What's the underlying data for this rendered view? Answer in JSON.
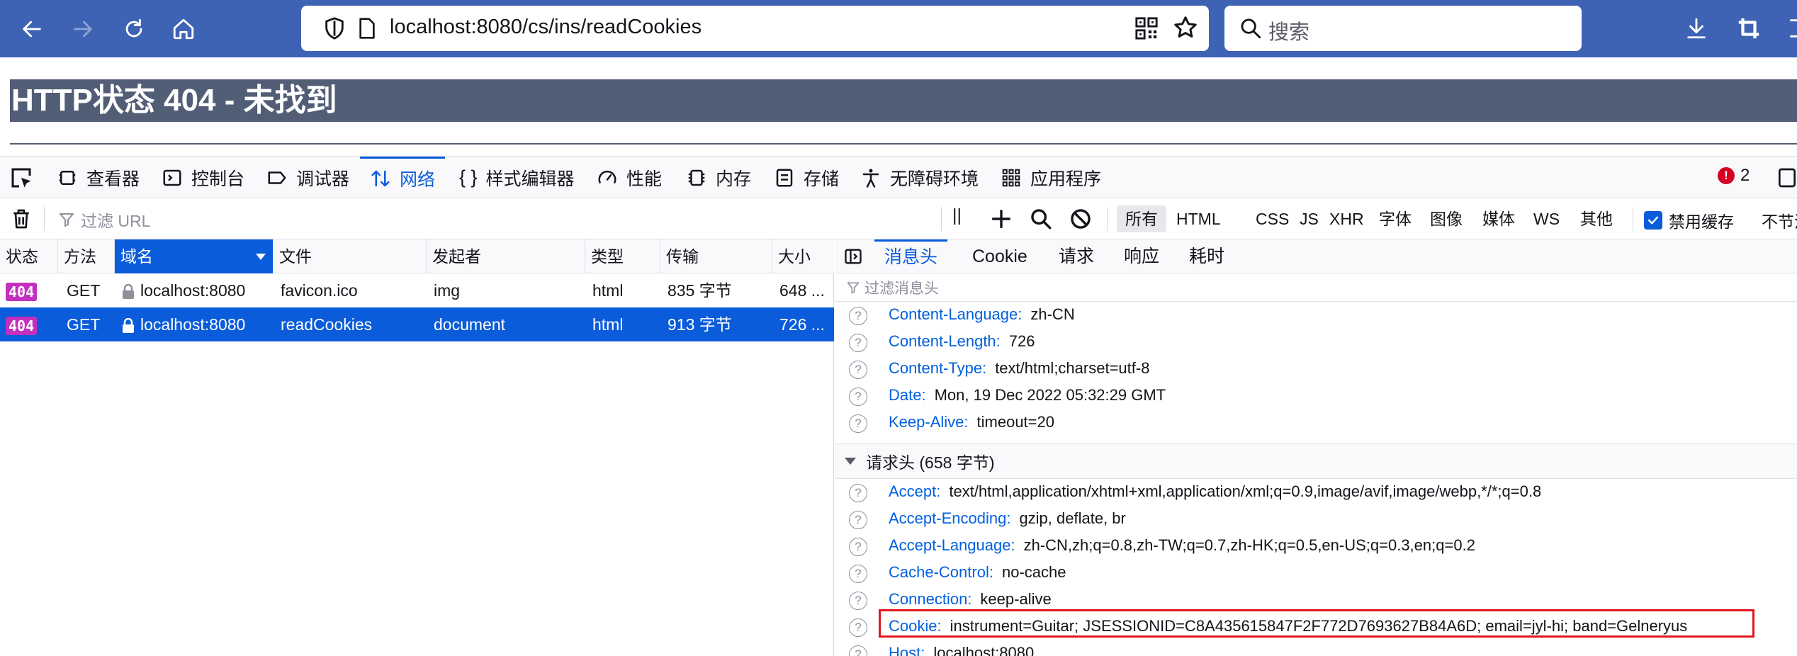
{
  "browser": {
    "url": "localhost:8080/cs/ins/readCookies",
    "search_placeholder": "搜索"
  },
  "page": {
    "error_title": "HTTP状态 404 - 未找到"
  },
  "devtools": {
    "tabs": [
      {
        "label": "查看器"
      },
      {
        "label": "控制台"
      },
      {
        "label": "调试器"
      },
      {
        "label": "网络"
      },
      {
        "label": "样式编辑器"
      },
      {
        "label": "性能"
      },
      {
        "label": "内存"
      },
      {
        "label": "存储"
      },
      {
        "label": "无障碍环境"
      },
      {
        "label": "应用程序"
      }
    ],
    "active_tab": "网络",
    "error_count": "2"
  },
  "network": {
    "filter_placeholder": "过滤 URL",
    "type_filters": [
      "所有",
      "HTML",
      "CSS",
      "JS",
      "XHR",
      "字体",
      "图像",
      "媒体",
      "WS",
      "其他"
    ],
    "active_filter": "所有",
    "disable_cache_label": "禁用缓存",
    "disable_cache_checked": true,
    "throttle_label": "不节流",
    "columns": [
      "状态",
      "方法",
      "域名",
      "文件",
      "发起者",
      "类型",
      "传输",
      "大小"
    ],
    "sorted_column": "域名",
    "requests": [
      {
        "status": "404",
        "method": "GET",
        "domain": "localhost:8080",
        "file": "favicon.ico",
        "initiator": "img",
        "type": "html",
        "transferred": "835 字节",
        "size": "648 ..."
      },
      {
        "status": "404",
        "method": "GET",
        "domain": "localhost:8080",
        "file": "readCookies",
        "initiator": "document",
        "type": "html",
        "transferred": "913 字节",
        "size": "726 ..."
      }
    ],
    "selected_request": 1
  },
  "details": {
    "tabs": [
      "消息头",
      "Cookie",
      "请求",
      "响应",
      "耗时"
    ],
    "active_tab": "消息头",
    "filter_placeholder": "过滤消息头",
    "response_headers": [
      {
        "name": "Content-Language:",
        "value": "zh-CN"
      },
      {
        "name": "Content-Length:",
        "value": "726"
      },
      {
        "name": "Content-Type:",
        "value": "text/html;charset=utf-8"
      },
      {
        "name": "Date:",
        "value": "Mon, 19 Dec 2022 05:32:29 GMT"
      },
      {
        "name": "Keep-Alive:",
        "value": "timeout=20"
      }
    ],
    "request_section_title": "请求头 (658 字节)",
    "request_headers": [
      {
        "name": "Accept:",
        "value": "text/html,application/xhtml+xml,application/xml;q=0.9,image/avif,image/webp,*/*;q=0.8"
      },
      {
        "name": "Accept-Encoding:",
        "value": "gzip, deflate, br"
      },
      {
        "name": "Accept-Language:",
        "value": "zh-CN,zh;q=0.8,zh-TW;q=0.7,zh-HK;q=0.5,en-US;q=0.3,en;q=0.2"
      },
      {
        "name": "Cache-Control:",
        "value": "no-cache"
      },
      {
        "name": "Connection:",
        "value": "keep-alive"
      },
      {
        "name": "Cookie:",
        "value": "instrument=Guitar; JSESSIONID=C8A435615847F2F772D7693627B84A6D; email=jyl-hi; band=Gelneryus"
      },
      {
        "name": "Host:",
        "value": "localhost:8080"
      }
    ],
    "highlight_color": "#e2171d"
  },
  "colors": {
    "browser_toolbar": "#3f63b4",
    "accent": "#0a5cda",
    "status_404": "#c32fbe",
    "error_title_bg": "#525d76"
  }
}
